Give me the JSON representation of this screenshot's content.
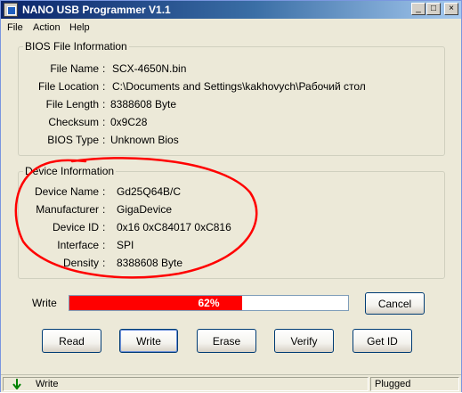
{
  "window": {
    "title": "NANO USB Programmer V1.1",
    "controls": {
      "minimize": "_",
      "maximize": "□",
      "close": "×"
    }
  },
  "menu": [
    "File",
    "Action",
    "Help"
  ],
  "bios": {
    "legend": "BIOS File Information",
    "rows": [
      {
        "label": "File Name",
        "value": "SCX-4650N.bin"
      },
      {
        "label": "File Location",
        "value": "C:\\Documents and Settings\\kakhovych\\Рабочий стол"
      },
      {
        "label": "File Length",
        "value": "8388608 Byte"
      },
      {
        "label": "Checksum",
        "value": "0x9C28"
      },
      {
        "label": "BIOS Type",
        "value": "Unknown Bios"
      }
    ]
  },
  "device": {
    "legend": "Device Information",
    "rows": [
      {
        "label": "Device Name",
        "value": "Gd25Q64B/C"
      },
      {
        "label": "Manufacturer",
        "value": "GigaDevice"
      },
      {
        "label": "Device ID",
        "value": "0x16 0xC84017 0xC816"
      },
      {
        "label": "Interface",
        "value": "SPI"
      },
      {
        "label": "Density",
        "value": "8388608 Byte"
      }
    ]
  },
  "separator": ":",
  "progress": {
    "label": "Write",
    "percent": 62,
    "text": "62%",
    "color": "#ff0000"
  },
  "buttons": {
    "cancel": "Cancel",
    "read": "Read",
    "write": "Write",
    "erase": "Erase",
    "verify": "Verify",
    "get_id": "Get ID"
  },
  "status": {
    "icon": "down-arrow-icon",
    "left": "Write",
    "right": "Plugged"
  },
  "colors": {
    "annotation": "#ff0000",
    "status_arrow": "#008000"
  }
}
